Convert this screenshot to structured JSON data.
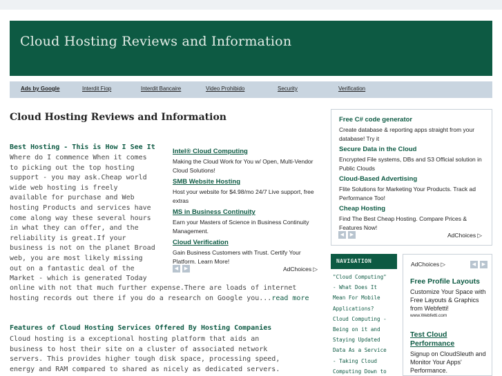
{
  "site": {
    "title": "Cloud Hosting Reviews and Information"
  },
  "linkbar": {
    "items": [
      "Ads by Google",
      "Interdit Fiop",
      "Interdit Bancaire",
      "Video Prohibido",
      "Security",
      "Verification"
    ]
  },
  "main": {
    "title": "Cloud Hosting Reviews and Information",
    "post1": {
      "title": "Best Hosting - This is How I See It",
      "lines": [
        "Where do I commence When it comes",
        "to picking out the top hosting",
        "support - you may ask.Cheap world",
        "wide web hosting is freely",
        "available for purchase and Web",
        "hosting Products and services have",
        "come along way these several hours",
        "in what they can offer, and the",
        "reliability is great.If your",
        "business is not on the planet Broad",
        "web, you are most likely missing",
        "out on a fantastic deal of the",
        "Market - which is generated Today"
      ],
      "wide_lines": [
        "online with not that much further expense.There are loads of",
        "internet hosting records out there if you do a research on Google"
      ],
      "last_prefix": "you...",
      "read_more": "read more"
    },
    "post2": {
      "title": "Features of Cloud Hosting Services Offered By Hosting Companies",
      "lines": [
        "Cloud hosting is a exceptional hosting platform that aids an",
        "business to host their site on a cluster of associated network",
        "servers. This provides higher tough disk space, processing speed,",
        "energy and RAM compared to shared as nicely as dedicated servers."
      ]
    }
  },
  "ads_middle": {
    "ads": [
      {
        "title": "Intel® Cloud Computing",
        "desc": "Making the Cloud Work for You w/ Open, Multi-Vendor Cloud Solutions!"
      },
      {
        "title": "SMB Website Hosting",
        "desc": "Host your website for $4.98/mo 24/7 Live support, free extras"
      },
      {
        "title": "MS in Business Continuity",
        "desc": "Earn your Masters of Science in Business Continuity Management."
      },
      {
        "title": "Cloud Verification",
        "desc": "Gain Business Customers with Trust. Certify Your Platform. Learn More!"
      }
    ],
    "adchoices": "AdChoices ▷"
  },
  "ads_right": {
    "ads": [
      {
        "title": "Free C# code generator",
        "desc": "Create database & reporting apps straight from your database! Try it"
      },
      {
        "title": "Secure Data in the Cloud",
        "desc": "Encrypted File systems, DBs and S3 Official solution in Public Clouds"
      },
      {
        "title": "Cloud-Based Advertising",
        "desc": "Flite Solutions for Marketing Your Products. Track ad Performance Too!"
      },
      {
        "title": "Cheap Hosting",
        "desc": "Find The Best Cheap Hosting. Compare Prices & Features Now!"
      }
    ],
    "adchoices": "AdChoices ▷"
  },
  "navigation": {
    "heading": "NAVIGATION",
    "lines": [
      "\"Cloud Computing\"",
      "- What Does It",
      "Mean For Mobile",
      "Applications?",
      "Cloud Computing -",
      "Being on it and",
      "Staying Updated",
      "Data As a Service",
      "- Taking Cloud",
      "Computing Down to"
    ]
  },
  "ads_box2": {
    "adchoices": "AdChoices ▷",
    "ads": [
      {
        "title": "Free Profile Layouts",
        "desc": "Customize Your Space with Free Layouts & Graphics from Webfetti!",
        "source": "www.Webfetti.com"
      },
      {
        "title": "Test Cloud Performance",
        "desc": "Signup on CloudSleuth and Monitor Your Apps' Performance.",
        "source": ""
      }
    ]
  },
  "icons": {
    "prev": "◀",
    "next": "▶"
  },
  "colors": {
    "brand_green": "#0d5a43",
    "linkbar_bg": "#c9d5e0",
    "page_bg": "#eef1f4"
  }
}
